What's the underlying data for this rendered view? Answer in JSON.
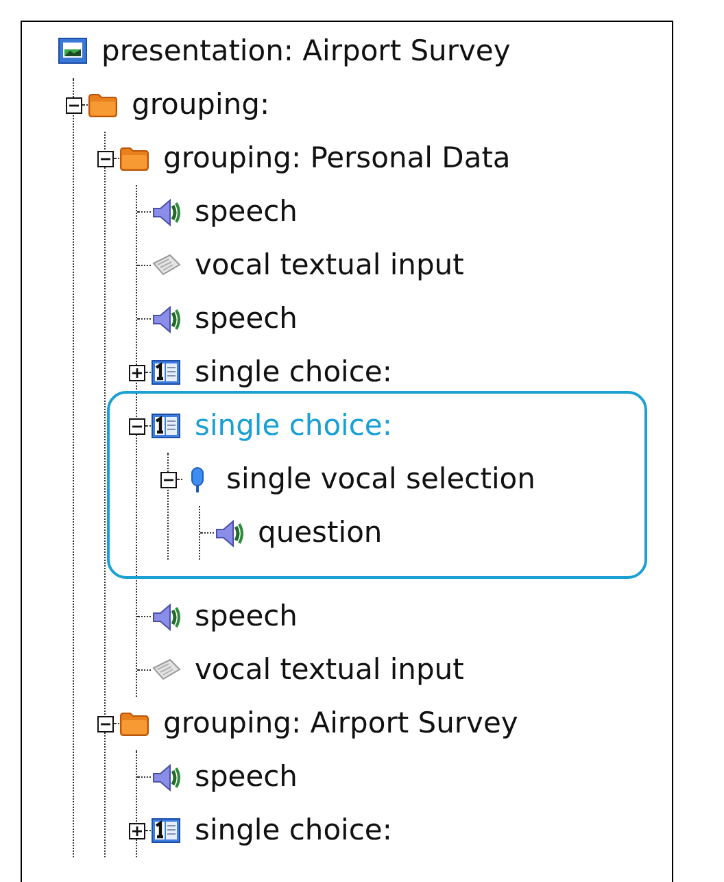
{
  "tree": [
    {
      "kind": "presentation",
      "label": "presentation: Airport Survey",
      "selected": false,
      "children": [
        {
          "kind": "grouping",
          "label": "grouping:",
          "selected": false,
          "expanded": true,
          "children": [
            {
              "kind": "grouping",
              "label": "grouping: Personal Data",
              "selected": false,
              "expanded": true,
              "children": [
                {
                  "kind": "speech",
                  "label": "speech",
                  "selected": false
                },
                {
                  "kind": "text_input",
                  "label": "vocal textual input",
                  "selected": false
                },
                {
                  "kind": "speech",
                  "label": "speech",
                  "selected": false
                },
                {
                  "kind": "choice",
                  "label": "single choice:",
                  "selected": false,
                  "expanded": false
                },
                {
                  "kind": "choice",
                  "label": "single choice:",
                  "selected": true,
                  "expanded": true,
                  "children": [
                    {
                      "kind": "vocal_selection",
                      "label": "single vocal selection",
                      "selected": false,
                      "expanded": true,
                      "children": [
                        {
                          "kind": "speech",
                          "label": "question",
                          "selected": false
                        }
                      ]
                    }
                  ]
                },
                {
                  "kind": "speech",
                  "label": "speech",
                  "selected": false
                },
                {
                  "kind": "text_input",
                  "label": "vocal textual input",
                  "selected": false
                }
              ]
            },
            {
              "kind": "grouping",
              "label": "grouping: Airport Survey",
              "selected": false,
              "expanded": true,
              "children": [
                {
                  "kind": "speech",
                  "label": "speech",
                  "selected": false
                },
                {
                  "kind": "choice",
                  "label": "single choice:",
                  "selected": false,
                  "expanded": false
                }
              ]
            }
          ]
        }
      ]
    }
  ]
}
